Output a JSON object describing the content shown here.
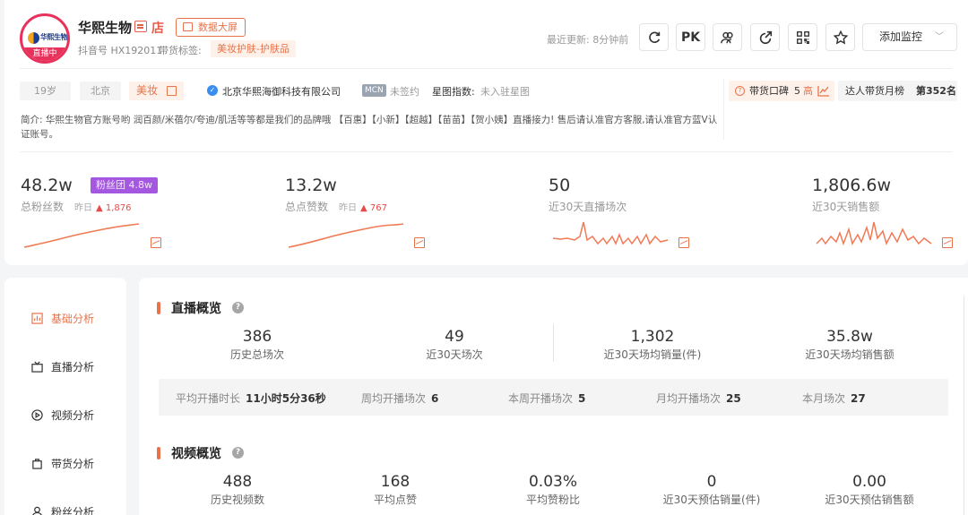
{
  "profile": {
    "name": "华熙生物",
    "store_icon": "店",
    "big_screen_label": "数据大屏",
    "avatar_logo_text": "华熙生物",
    "avatar_live_label": "直播中",
    "dy_id": "抖音号 HX192011",
    "tag_label": "带货标签:",
    "category_tag": "美妆护肤-护肤品",
    "update_text": "最近更新: 8分钟前",
    "pk_label": "PK",
    "monitor_label": "添加监控",
    "age": "19岁",
    "city": "北京",
    "category": "美妆",
    "verified_mark": "✓",
    "company": "北京华熙海御科技有限公司",
    "mcn_badge": "MCN",
    "mcn_status": "未签约",
    "star_label": "星图指数:",
    "star_value": "未入驻星图",
    "koubei_label": "带货口碑",
    "koubei_score": "5",
    "koubei_level": "高",
    "rank_label": "达人带货月榜",
    "rank_value": "第352名",
    "intro": "简介: 华熙生物官方账号哟 润百颜/米蓓尔/夸迪/肌活等等都是我们的品牌哦 【百惠】【小新】【超越】【苗苗】【贺小姨】直播接力! 售后请认准官方客服,请认准官方蓝V认证账号。"
  },
  "stats": [
    {
      "value": "48.2w",
      "label": "总粉丝数",
      "yesterday_label": "昨日",
      "delta": "▲ 1,876",
      "badge_label": "粉丝团",
      "badge_value": "4.8w"
    },
    {
      "value": "13.2w",
      "label": "总点赞数",
      "yesterday_label": "昨日",
      "delta": "▲ 767"
    },
    {
      "value": "50",
      "label": "近30天直播场次"
    },
    {
      "value": "1,806.6w",
      "label": "近30天销售额"
    }
  ],
  "sidebar": {
    "items": [
      {
        "label": "基础分析",
        "icon": "bar-chart-icon",
        "active": true
      },
      {
        "label": "直播分析",
        "icon": "live-icon",
        "active": false
      },
      {
        "label": "视频分析",
        "icon": "play-icon",
        "active": false
      },
      {
        "label": "带货分析",
        "icon": "bag-icon",
        "active": false
      },
      {
        "label": "粉丝分析",
        "icon": "user-icon",
        "active": false
      }
    ]
  },
  "live_overview": {
    "title": "直播概览",
    "help": "?",
    "metrics": [
      {
        "value": "386",
        "label": "历史总场次"
      },
      {
        "value": "49",
        "label": "近30天场次"
      },
      {
        "value": "1,302",
        "label": "近30天场均销量(件)"
      },
      {
        "value": "35.8w",
        "label": "近30天场均销售额"
      }
    ],
    "bar": [
      {
        "label": "平均开播时长",
        "value": "11小时5分36秒"
      },
      {
        "label": "周均开播场次",
        "value": "6"
      },
      {
        "label": "本周开播场次",
        "value": "5"
      },
      {
        "label": "月均开播场次",
        "value": "25"
      },
      {
        "label": "本月场次",
        "value": "27"
      }
    ]
  },
  "video_overview": {
    "title": "视频概览",
    "help": "?",
    "metrics": [
      {
        "value": "488",
        "label": "历史视频数"
      },
      {
        "value": "168",
        "label": "平均点赞"
      },
      {
        "value": "0.03%",
        "label": "平均赞粉比"
      },
      {
        "value": "0",
        "label": "近30天预估销量(件)"
      },
      {
        "value": "0.00",
        "label": "近30天预估销售额"
      }
    ]
  },
  "colors": {
    "accent": "#e8734a",
    "live": "#e8325b",
    "fans_badge": "#a458e0",
    "up": "#e84a4a"
  }
}
